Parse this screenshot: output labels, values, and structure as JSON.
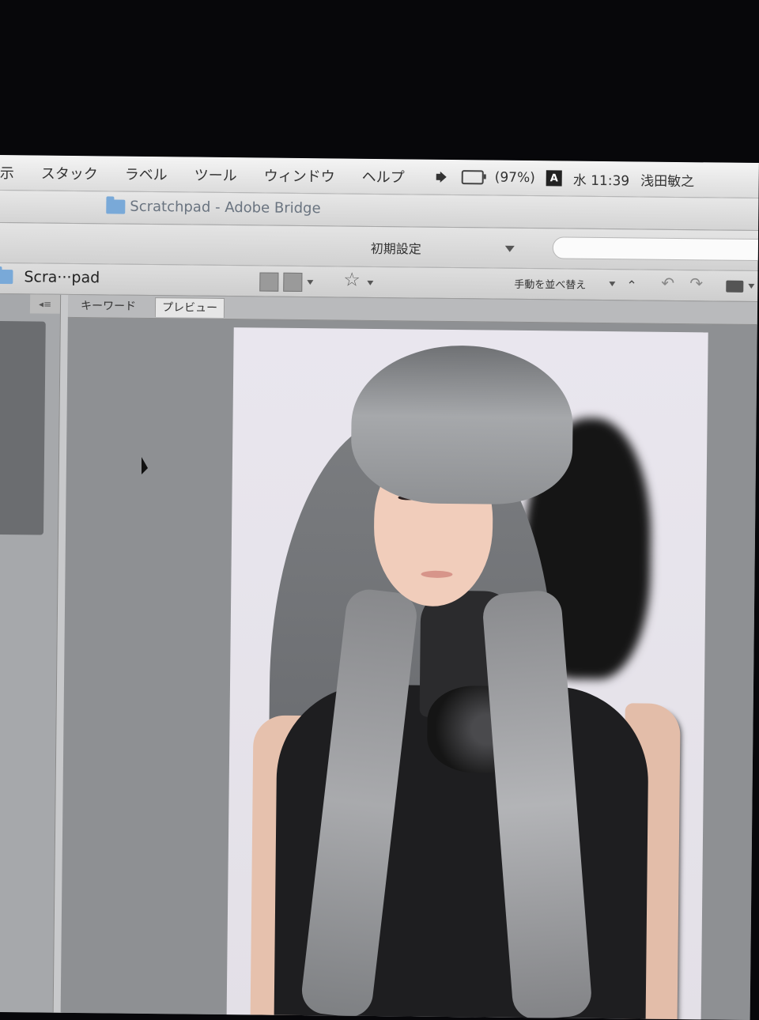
{
  "menubar": {
    "items": [
      "示",
      "スタック",
      "ラベル",
      "ツール",
      "ウィンドウ",
      "ヘルプ"
    ],
    "battery": "(97%)",
    "ime": "A",
    "clock": "水 11:39",
    "user": "浅田敏之"
  },
  "window": {
    "title": "Scratchpad - Adobe Bridge"
  },
  "toolbar": {
    "workspace": "初期設定",
    "search_placeholder": ""
  },
  "pathbar": {
    "path": "Scra···pad",
    "sort_label": "手動を並べ替え"
  },
  "tabs": {
    "keyword": "キーワード",
    "preview": "プレビュー"
  }
}
